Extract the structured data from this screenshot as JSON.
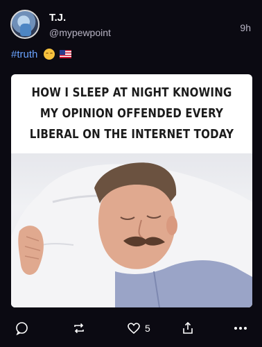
{
  "post": {
    "author": {
      "display_name": "T.J.",
      "handle": "@mypewpoint",
      "avatar": "avatar-image"
    },
    "time": "9h",
    "caption": {
      "hashtag": "#truth",
      "emoji": [
        "relieved-face-emoji",
        "us-flag-emoji"
      ]
    },
    "meme": {
      "lines": [
        "HOW I SLEEP AT NIGHT KNOWING",
        "MY OPINION OFFENDED EVERY",
        "LIBERAL ON THE INTERNET TODAY"
      ],
      "image": "sleeping-man-photo"
    },
    "actions": {
      "reply_icon": "reply-icon",
      "repost_icon": "repost-icon",
      "like_icon": "heart-icon",
      "like_count": "5",
      "share_icon": "share-icon",
      "more_icon": "more-icon"
    }
  },
  "colors": {
    "background": "#0b0a12",
    "hashtag": "#6aa3ff",
    "secondary_text": "#b8b4c4"
  }
}
